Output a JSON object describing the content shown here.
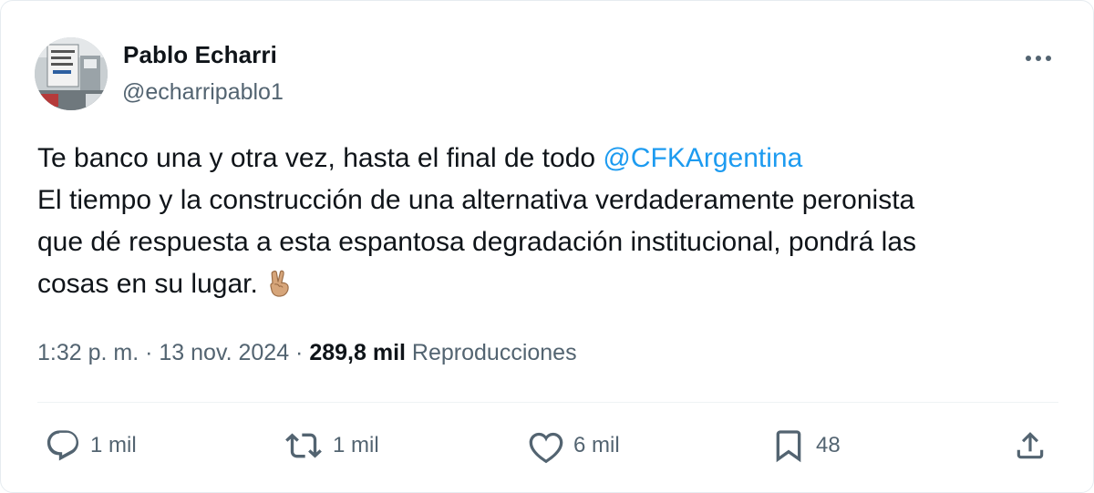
{
  "author": {
    "name": "Pablo Echarri",
    "handle": "@echarripablo1"
  },
  "tweet": {
    "text_line1": "Te banco una y otra vez, hasta el final de todo ",
    "mention": "@CFKArgentina",
    "text_line2": "El tiempo y la construcción de una alternativa verdaderamente peronista",
    "text_line3": "que dé respuesta a esta espantosa degradación institucional, pondrá las",
    "text_line4": "cosas en su lugar.",
    "emoji": "victory-hand-emoji"
  },
  "meta": {
    "time": "1:32 p. m.",
    "separator": " · ",
    "date": "13 nov. 2024",
    "views_count": "289,8 mil",
    "views_label": " Reproducciones"
  },
  "actions": {
    "replies": "1 mil",
    "reposts": "1 mil",
    "likes": "6 mil",
    "bookmarks": "48"
  },
  "icons": {
    "reply": "reply-icon",
    "repost": "repost-icon",
    "like": "heart-icon",
    "bookmark": "bookmark-icon",
    "share": "share-icon",
    "more": "more-icon"
  },
  "colors": {
    "text": "#0f1419",
    "secondary": "#536471",
    "link": "#1d9bf0"
  }
}
